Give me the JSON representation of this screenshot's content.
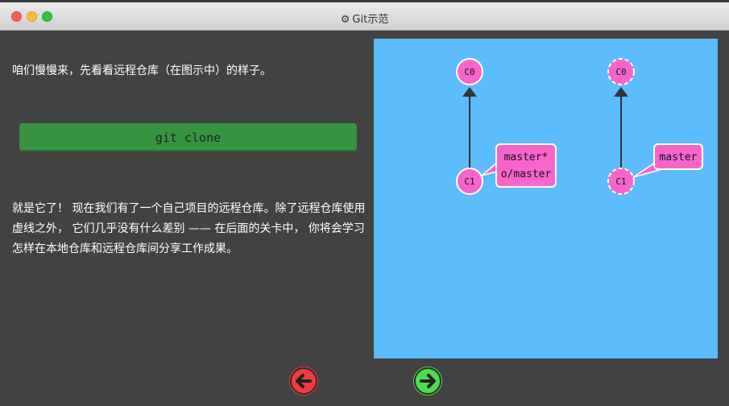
{
  "window": {
    "title": "Git示范",
    "gear_icon": "⚙"
  },
  "left": {
    "intro": "咱们慢慢来，先看看远程仓库（在图示中）的样子。",
    "command_button": "git clone",
    "description": "就是它了！ 现在我们有了一个自己项目的远程仓库。除了远程仓库使用虚线之外， 它们几乎没有什么差别 —— 在后面的关卡中， 你将会学习怎样在本地仓库和远程仓库间分享工作成果。"
  },
  "graph": {
    "local": {
      "c0": "C0",
      "c1": "C1",
      "branch_line1": "master*",
      "branch_line2": "o/master"
    },
    "remote": {
      "c0": "C0",
      "c1": "C1",
      "branch": "master"
    },
    "colors": {
      "canvas": "#5cbcfc",
      "node": "#f765cc",
      "edge": "#333333"
    }
  },
  "nav": {
    "prev_icon": "arrow-left-icon",
    "next_icon": "arrow-right-icon"
  }
}
